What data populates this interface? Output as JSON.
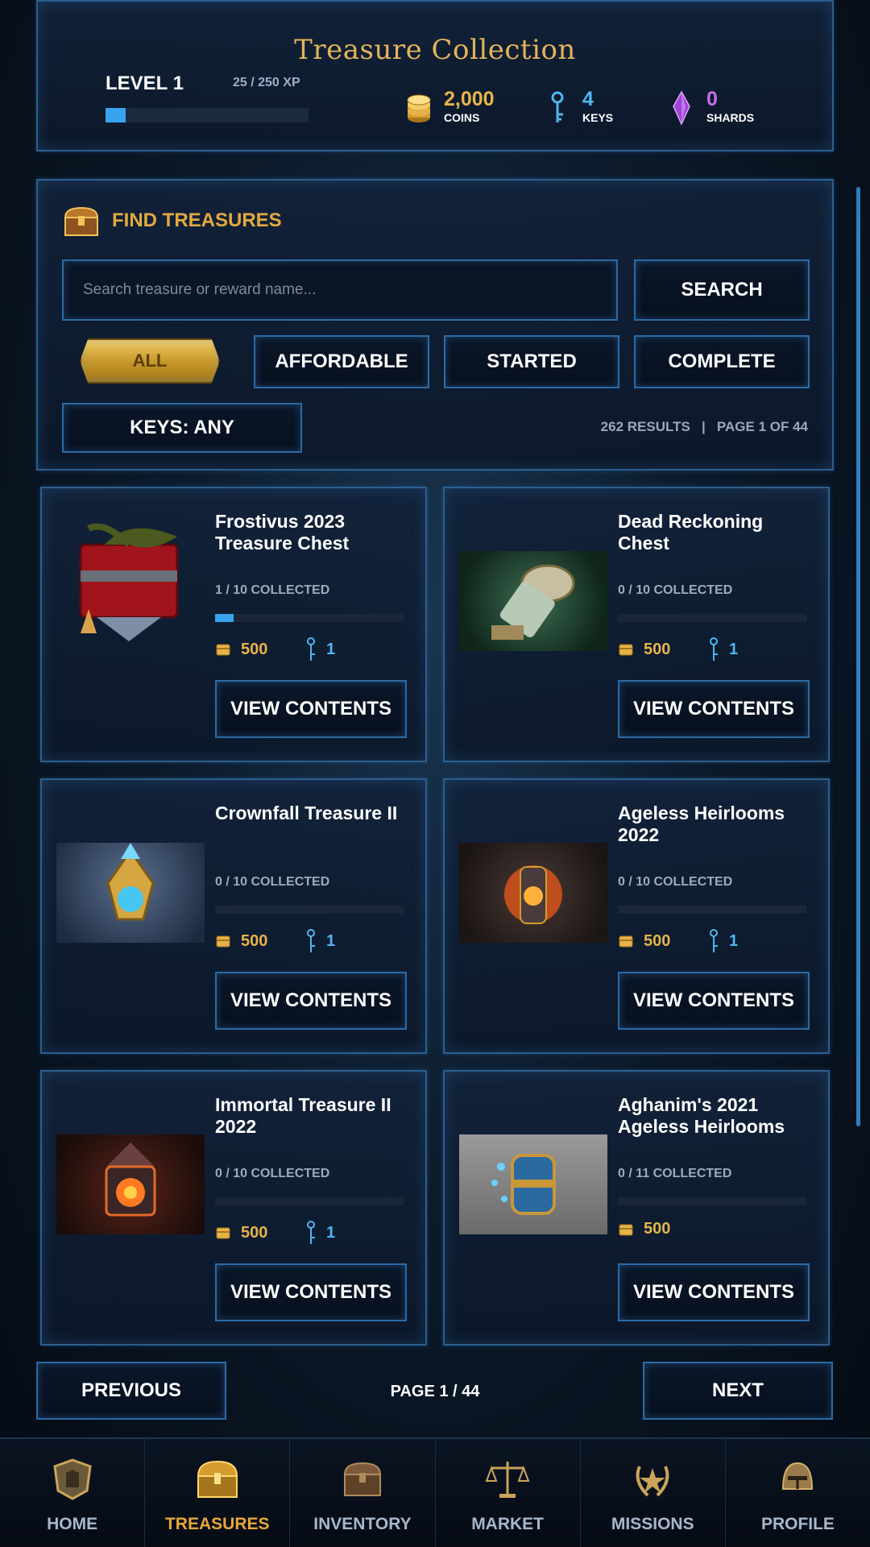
{
  "header": {
    "title": "Treasure Collection",
    "level": "LEVEL 1",
    "xp_text": "25 / 250 XP",
    "xp_progress": 0.1,
    "coins": {
      "value": "2,000",
      "label": "COINS"
    },
    "keys": {
      "value": "4",
      "label": "KEYS"
    },
    "shards": {
      "value": "0",
      "label": "SHARDS"
    }
  },
  "finder": {
    "title": "FIND TREASURES",
    "search_placeholder": "Search treasure or reward name...",
    "search_button": "SEARCH",
    "filters": [
      "ALL",
      "AFFORDABLE",
      "STARTED",
      "COMPLETE"
    ],
    "active_filter": "ALL",
    "keys_filter": "KEYS: ANY",
    "results_text": "262 RESULTS   |   PAGE 1 OF 44"
  },
  "cards": [
    {
      "title": "Frostivus 2023 Treasure Chest",
      "collected": "1 / 10 COLLECTED",
      "progress": 0.1,
      "cost": "500",
      "keys": "1",
      "button": "VIEW CONTENTS"
    },
    {
      "title": "Dead Reckoning Chest",
      "collected": "0 / 10 COLLECTED",
      "progress": 0,
      "cost": "500",
      "keys": "1",
      "button": "VIEW CONTENTS"
    },
    {
      "title": "Crownfall Treasure II",
      "collected": "0 / 10 COLLECTED",
      "progress": 0,
      "cost": "500",
      "keys": "1",
      "button": "VIEW CONTENTS"
    },
    {
      "title": "Ageless Heirlooms 2022",
      "collected": "0 / 10 COLLECTED",
      "progress": 0,
      "cost": "500",
      "keys": "1",
      "button": "VIEW CONTENTS"
    },
    {
      "title": "Immortal Treasure II 2022",
      "collected": "0 / 10 COLLECTED",
      "progress": 0,
      "cost": "500",
      "keys": "1",
      "button": "VIEW CONTENTS"
    },
    {
      "title": "Aghanim's 2021 Ageless Heirlooms",
      "collected": "0 / 11 COLLECTED",
      "progress": 0,
      "cost": "500",
      "keys": "",
      "button": "VIEW CONTENTS"
    }
  ],
  "pagination": {
    "previous": "PREVIOUS",
    "page": "PAGE 1 / 44",
    "next": "NEXT"
  },
  "nav": {
    "items": [
      "HOME",
      "TREASURES",
      "INVENTORY",
      "MARKET",
      "MISSIONS",
      "PROFILE"
    ],
    "active": "TREASURES"
  },
  "colors": {
    "gold": "#e6b34a",
    "key_blue": "#4fb6f0",
    "shard_purple": "#cb6be8",
    "border_blue": "#2b6aa5"
  }
}
